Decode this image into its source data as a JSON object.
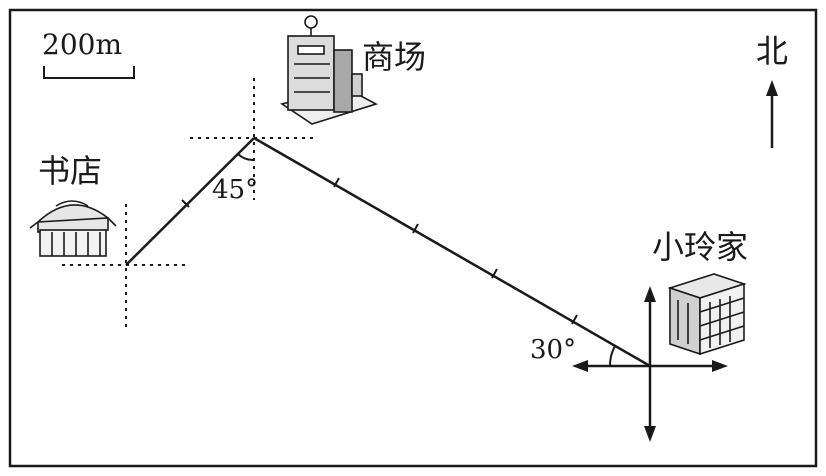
{
  "scale": {
    "label": "200m"
  },
  "north": {
    "label": "北"
  },
  "places": {
    "bookstore": "书店",
    "mall": "商场",
    "home": "小玲家"
  },
  "angles": {
    "at_mall": "45°",
    "at_home": "30°"
  },
  "colors": {
    "ink": "#1a1a1a",
    "paper": "#ffffff"
  }
}
